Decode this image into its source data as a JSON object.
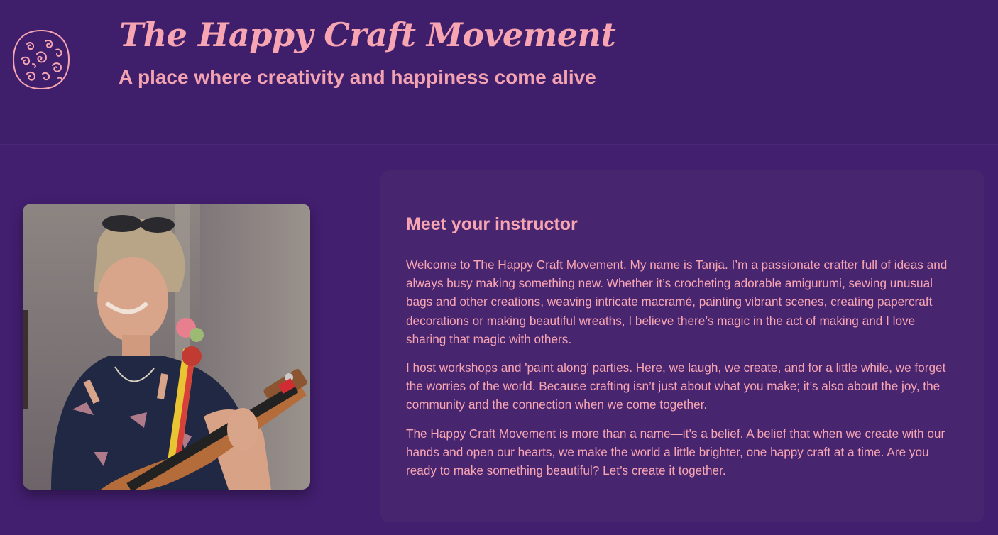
{
  "header": {
    "logo_icon": "spiral-pattern-logo-icon",
    "title": "The Happy Craft Movement",
    "tagline": "A place where creativity and happiness come alive"
  },
  "instructor": {
    "photo_icon": "instructor-photo",
    "heading": "Meet your instructor",
    "paragraphs": [
      "Welcome to The Happy Craft Movement. My name is Tanja. I’m a passionate crafter full of ideas and always busy making something new. Whether it’s crocheting adorable amigurumi, sewing unusual bags and other creations, weaving intricate macramé, painting vibrant scenes, creating papercraft decorations or making beautiful wreaths, I believe there’s magic in the act of making and I love sharing that magic with others.",
      "I host workshops and 'paint along' parties. Here, we laugh, we create, and for a little while, we forget the worries of the world. Because crafting isn’t just about what you make; it’s also about the joy, the community and the connection when we come together.",
      "The Happy Craft Movement is more than a name—it’s a belief. A belief that when we create with our hands and open our hearts, we make the world a little brighter, one happy craft at a time. Are you ready to make something beautiful? Let’s create it together."
    ]
  },
  "colors": {
    "background": "#3f1f6b",
    "card": "#48256f",
    "accent_pink": "#f8a5b3"
  }
}
